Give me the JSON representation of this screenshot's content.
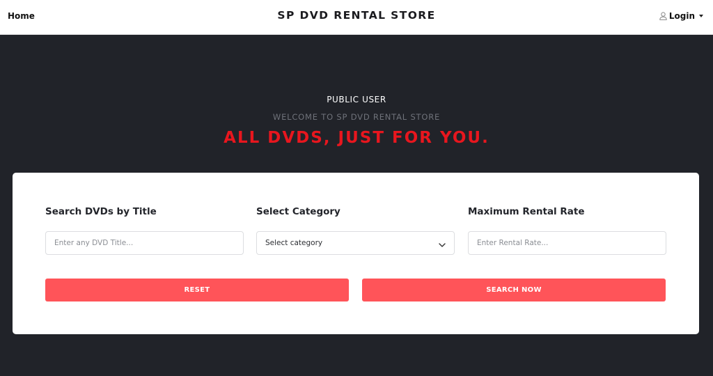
{
  "nav": {
    "home": "Home",
    "brand": "SP DVD RENTAL STORE",
    "login": "Login",
    "login_icon": "user-icon"
  },
  "hero": {
    "subtitle": "PUBLIC USER",
    "welcome": "WELCOME TO SP DVD RENTAL STORE",
    "title": "ALL DVDS, JUST FOR YOU."
  },
  "search": {
    "title_label": "Search DVDs by Title",
    "title_placeholder": "Enter any DVD Title...",
    "category_label": "Select Category",
    "category_selected": "Select category",
    "rate_label": "Maximum Rental Rate",
    "rate_placeholder": "Enter Rental Rate...",
    "reset_label": "RESET",
    "search_label": "SEARCH NOW"
  },
  "colors": {
    "accent": "#e8161e",
    "button": "#ff5459",
    "background": "#212329"
  }
}
